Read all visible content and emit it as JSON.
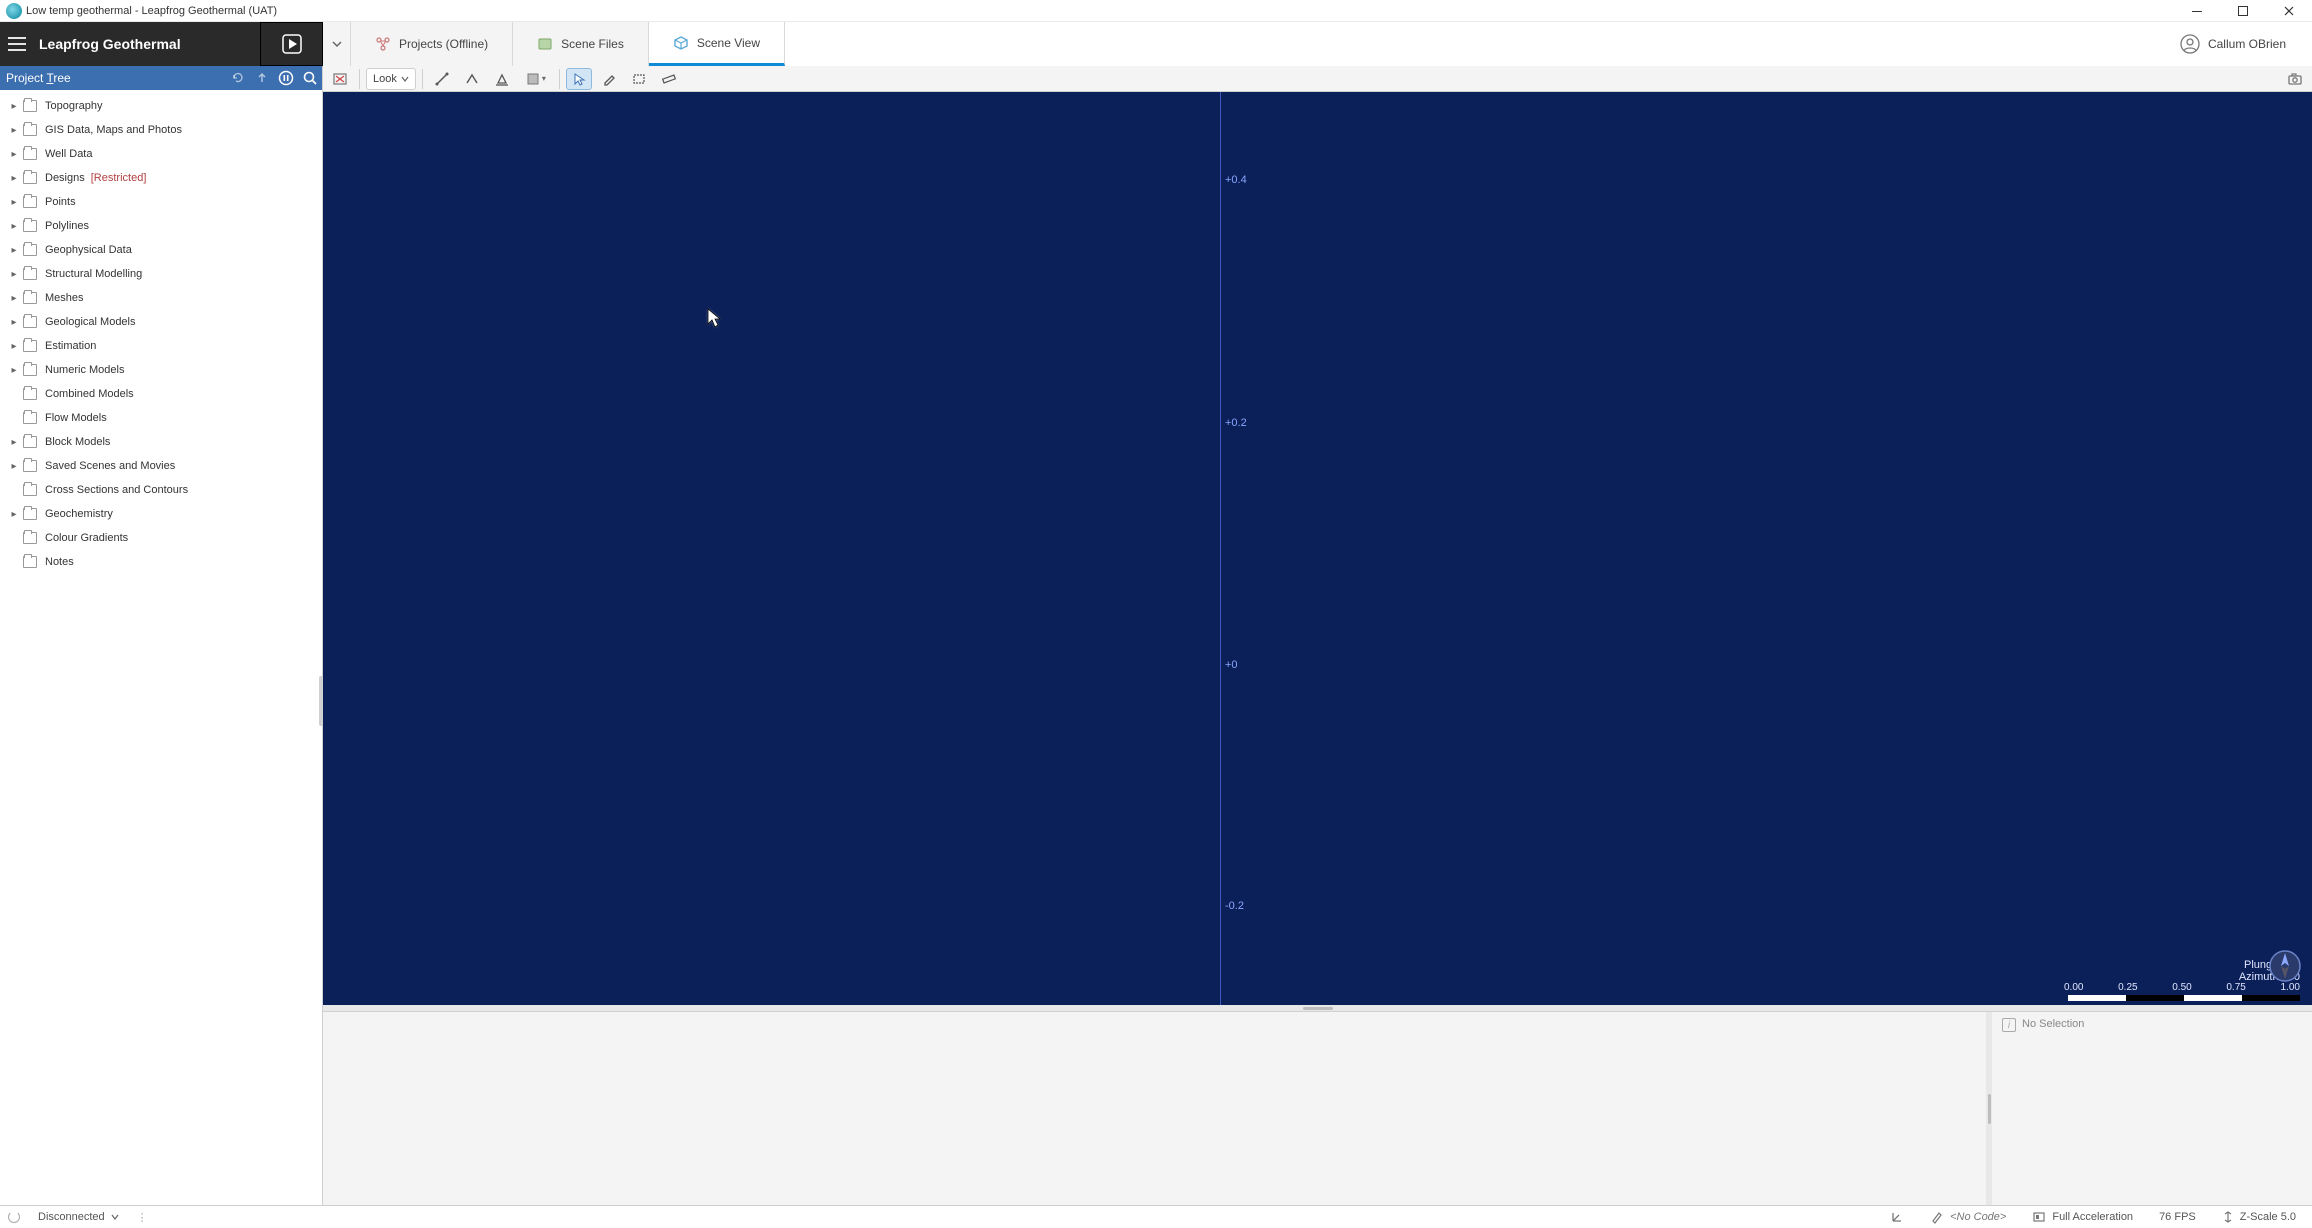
{
  "window": {
    "title": "Low temp geothermal - Leapfrog Geothermal (UAT)"
  },
  "brand": "Leapfrog Geothermal",
  "tabs": {
    "projects": "Projects (Offline)",
    "scene_files": "Scene Files",
    "scene_view": "Scene View"
  },
  "user": {
    "name": "Callum OBrien"
  },
  "project_tree": {
    "title_pre": "Project ",
    "title_ul": "T",
    "title_post": "ree",
    "items": [
      {
        "label": "Topography",
        "expandable": true
      },
      {
        "label": "GIS Data, Maps and Photos",
        "expandable": true
      },
      {
        "label": "Well Data",
        "expandable": true
      },
      {
        "label": "Designs",
        "expandable": true,
        "suffix": "[Restricted]"
      },
      {
        "label": "Points",
        "expandable": true
      },
      {
        "label": "Polylines",
        "expandable": true
      },
      {
        "label": "Geophysical Data",
        "expandable": true
      },
      {
        "label": "Structural Modelling",
        "expandable": true
      },
      {
        "label": "Meshes",
        "expandable": true
      },
      {
        "label": "Geological Models",
        "expandable": true
      },
      {
        "label": "Estimation",
        "expandable": true
      },
      {
        "label": "Numeric Models",
        "expandable": true
      },
      {
        "label": "Combined Models",
        "expandable": false
      },
      {
        "label": "Flow Models",
        "expandable": false
      },
      {
        "label": "Block Models",
        "expandable": true
      },
      {
        "label": "Saved Scenes and Movies",
        "expandable": true
      },
      {
        "label": "Cross Sections and Contours",
        "expandable": false
      },
      {
        "label": "Geochemistry",
        "expandable": true
      },
      {
        "label": "Colour Gradients",
        "expandable": false
      },
      {
        "label": "Notes",
        "expandable": false
      }
    ]
  },
  "toolbar": {
    "look": "Look"
  },
  "viewport": {
    "axis_labels": [
      "+0.4",
      "+0.2",
      "+0",
      "-0.2"
    ],
    "plunge": "Plunge  +04",
    "azimuth": "Azimuth  030",
    "scale_ticks": [
      "0.00",
      "0.25",
      "0.50",
      "0.75",
      "1.00"
    ]
  },
  "lower": {
    "no_selection": "No Selection"
  },
  "status": {
    "connection": "Disconnected",
    "code": "<No Code>",
    "accel": "Full Acceleration",
    "fps": "76 FPS",
    "zscale": "Z-Scale 5.0"
  }
}
